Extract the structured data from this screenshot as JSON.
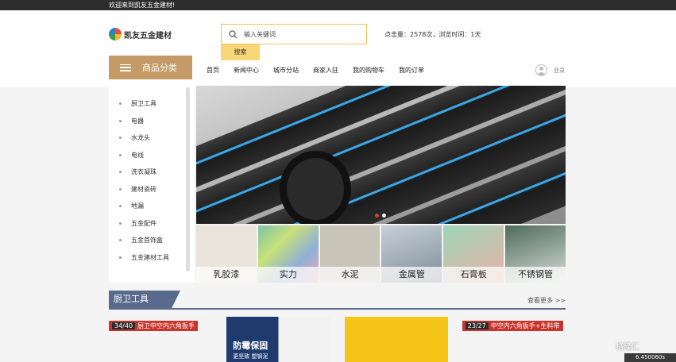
{
  "topbar": {
    "welcome": "欢迎来到凯友五金建材!"
  },
  "logo": {
    "text": "凯友五金建材"
  },
  "search": {
    "placeholder": "输入关键词",
    "button": "搜索"
  },
  "stats": {
    "text": "点击量：2578次，浏览时间：1天"
  },
  "category": {
    "title": "商品分类"
  },
  "nav": {
    "items": [
      "首页",
      "新闻中心",
      "城市分站",
      "商家入驻",
      "我的购物车",
      "我的订单"
    ]
  },
  "login": {
    "label": "登录"
  },
  "sidebar": {
    "items": [
      "厨卫工具",
      "电器",
      "水龙头",
      "电线",
      "洗衣凝珠",
      "建材瓷砖",
      "地漏",
      "五金配件",
      "五金首饰盒",
      "五金建材工具"
    ]
  },
  "tiles": [
    {
      "label": "乳胶漆",
      "color": "#e8e4dc"
    },
    {
      "label": "实力",
      "color": "#9ec7b4"
    },
    {
      "label": "水泥",
      "color": "#c9c4b8"
    },
    {
      "label": "金属管",
      "color": "#9aa7b2"
    },
    {
      "label": "石膏板",
      "color": "#d9b0a4"
    },
    {
      "label": "不锈钢管",
      "color": "#6f8a78"
    }
  ],
  "section": {
    "title": "厨卫工具",
    "more": "查看更多 >>"
  },
  "products": {
    "p1": {
      "count": "34/40",
      "text": "厨卫中空内六角扳手"
    },
    "p2": {
      "title": "防霉保固",
      "sub": "更坚致  塑钢泥"
    },
    "p4": {
      "count": "23/27",
      "text": "中空内六角扳手+生料带"
    }
  },
  "overlay": {
    "watermark": "格隆汇",
    "time": "6.450060s"
  }
}
